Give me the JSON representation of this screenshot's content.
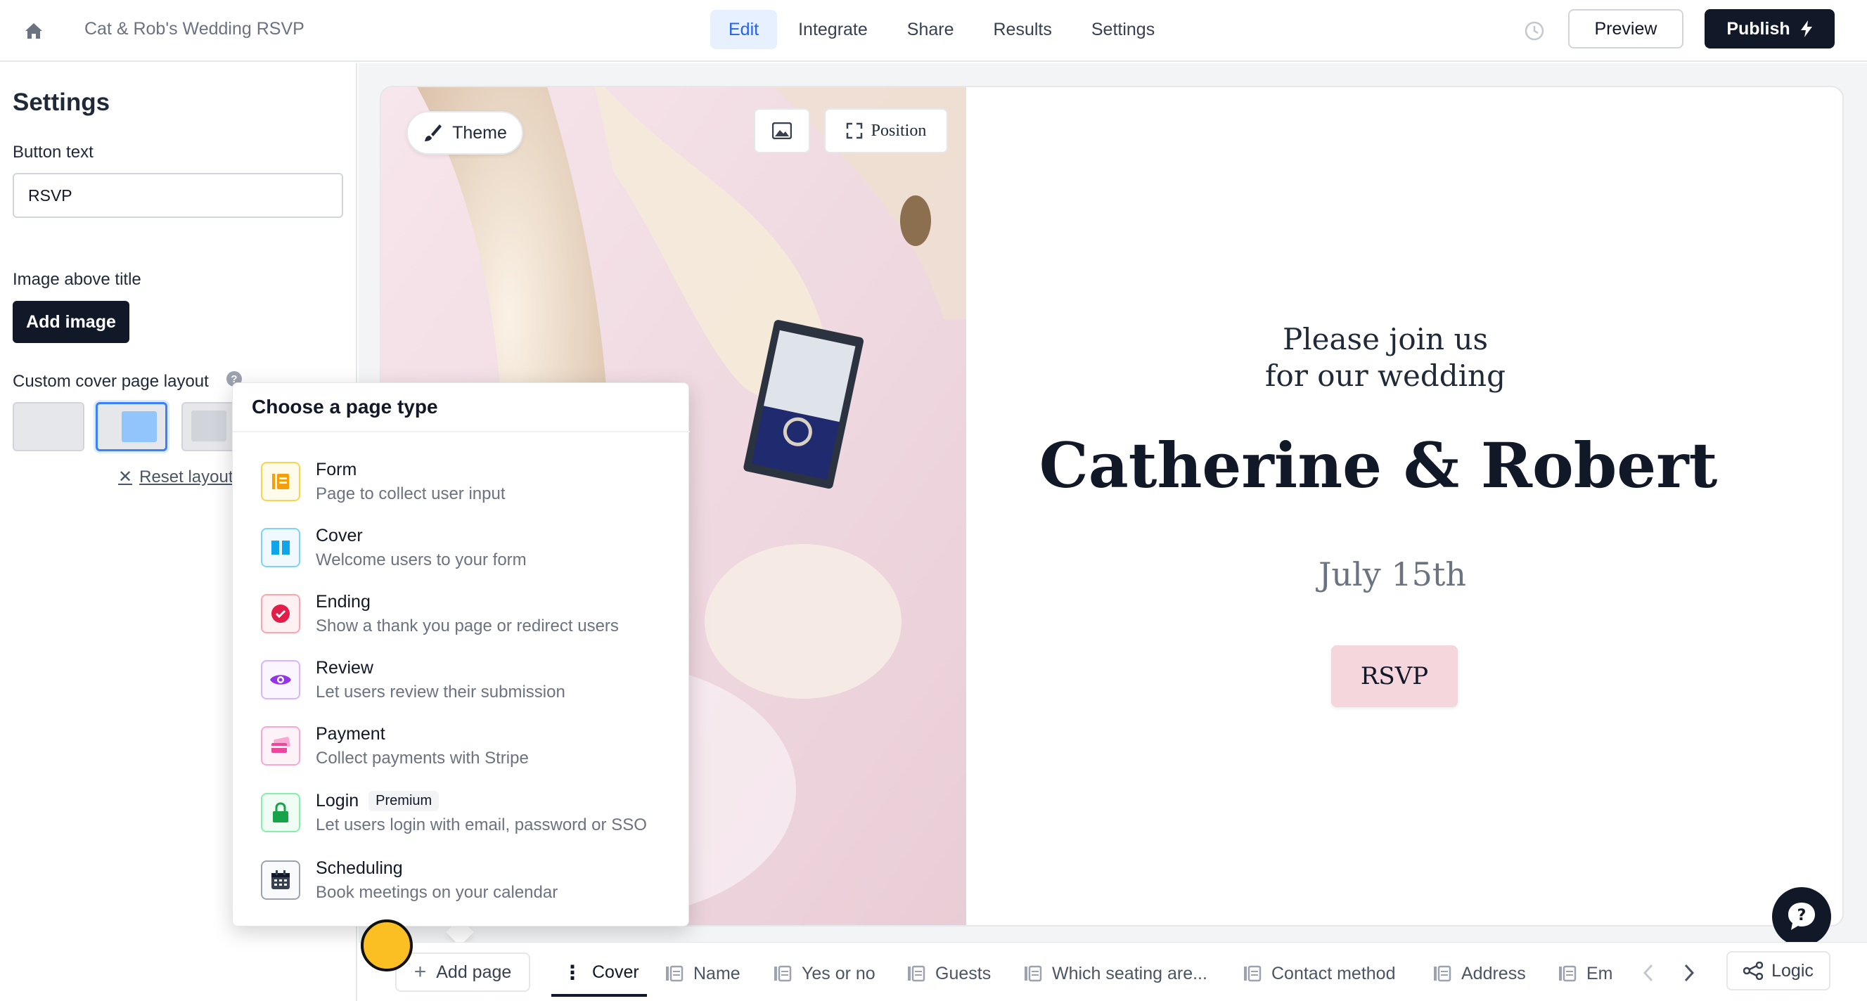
{
  "header": {
    "app_title": "Cat & Rob's Wedding RSVP",
    "tabs": [
      "Edit",
      "Integrate",
      "Share",
      "Results",
      "Settings"
    ],
    "active_tab": "Edit",
    "preview_label": "Preview",
    "publish_label": "Publish"
  },
  "settings": {
    "title": "Settings",
    "button_text_label": "Button text",
    "button_text_value": "RSVP",
    "image_label": "Image above title",
    "add_image_label": "Add image",
    "layout_label": "Custom cover page layout",
    "reset_label": "Reset layout"
  },
  "toolbar": {
    "theme_label": "Theme",
    "position_label": "Position"
  },
  "cover": {
    "line1": "Please join us",
    "line2": "for our wedding",
    "names": "Catherine & Robert",
    "date": "July 15th",
    "button": "RSVP"
  },
  "menu": {
    "title": "Choose a page type",
    "items": [
      {
        "title": "Form",
        "desc": "Page to collect user input",
        "color": "#f59e0b"
      },
      {
        "title": "Cover",
        "desc": "Welcome users to your form",
        "color": "#0ea5e9"
      },
      {
        "title": "Ending",
        "desc": "Show a thank you page or redirect users",
        "color": "#e11d48"
      },
      {
        "title": "Review",
        "desc": "Let users review their submission",
        "color": "#9333ea"
      },
      {
        "title": "Payment",
        "desc": "Collect payments with Stripe",
        "color": "#ec4899"
      },
      {
        "title": "Login",
        "badge": "Premium",
        "desc": "Let users login with email, password or SSO",
        "color": "#16a34a"
      },
      {
        "title": "Scheduling",
        "desc": "Book meetings on your calendar",
        "color": "#374151"
      }
    ]
  },
  "bottom": {
    "add_page_label": "Add page",
    "pages": [
      "Cover",
      "Name",
      "Yes or no",
      "Guests",
      "Which seating are...",
      "Contact method",
      "Address",
      "Em"
    ],
    "active_page": "Cover",
    "logic_label": "Logic"
  }
}
